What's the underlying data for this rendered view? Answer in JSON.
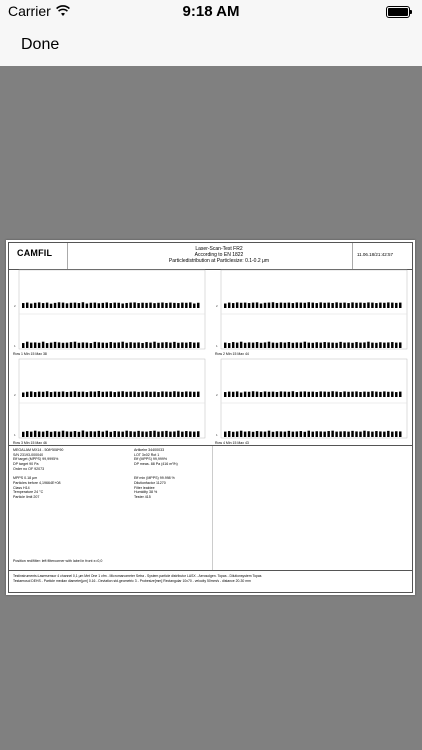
{
  "status_bar": {
    "carrier": "Carrier",
    "time": "9:18 AM"
  },
  "navbar": {
    "done_label": "Done"
  },
  "report": {
    "logo": "CAMFIL",
    "title": "Laser-Scan-Test FR2",
    "standard": "According to EN 1822",
    "distribution": "Particledistribution at Particlesize: 0.1-0.2 μm",
    "datetime": "11.06.18/21:42:57",
    "panels": [
      {
        "row_label": "Row 1 Min 15 Max 38",
        "values_top": [
          0.55,
          0.6,
          0.5,
          0.58,
          0.62,
          0.55,
          0.6,
          0.48,
          0.57,
          0.63,
          0.6,
          0.52,
          0.58,
          0.6,
          0.55,
          0.64,
          0.5,
          0.58,
          0.6,
          0.53,
          0.57,
          0.62,
          0.55,
          0.6,
          0.58,
          0.5,
          0.56,
          0.6,
          0.62,
          0.55,
          0.59,
          0.57,
          0.6,
          0.54,
          0.58,
          0.61,
          0.56,
          0.6,
          0.57,
          0.55,
          0.6,
          0.58,
          0.62,
          0.5,
          0.58
        ],
        "values_bottom": [
          0.55,
          0.7,
          0.6,
          0.62,
          0.58,
          0.7,
          0.55,
          0.6,
          0.68,
          0.62,
          0.58,
          0.6,
          0.65,
          0.7,
          0.58,
          0.62,
          0.6,
          0.55,
          0.68,
          0.63,
          0.6,
          0.58,
          0.66,
          0.6,
          0.62,
          0.7,
          0.58,
          0.64,
          0.6,
          0.62,
          0.56,
          0.66,
          0.6,
          0.7,
          0.58,
          0.62,
          0.65,
          0.6,
          0.68,
          0.58,
          0.62,
          0.6,
          0.66,
          0.6,
          0.62
        ]
      },
      {
        "row_label": "Row 2 Min 15 Max 44",
        "values_top": [
          0.5,
          0.6,
          0.55,
          0.62,
          0.58,
          0.6,
          0.55,
          0.6,
          0.62,
          0.5,
          0.58,
          0.6,
          0.64,
          0.56,
          0.6,
          0.58,
          0.6,
          0.55,
          0.62,
          0.6,
          0.58,
          0.64,
          0.6,
          0.55,
          0.62,
          0.58,
          0.6,
          0.56,
          0.63,
          0.58,
          0.6,
          0.55,
          0.62,
          0.58,
          0.6,
          0.57,
          0.62,
          0.6,
          0.55,
          0.6,
          0.58,
          0.62,
          0.6,
          0.57,
          0.6
        ],
        "values_bottom": [
          0.6,
          0.55,
          0.66,
          0.6,
          0.7,
          0.58,
          0.62,
          0.6,
          0.66,
          0.58,
          0.62,
          0.7,
          0.6,
          0.58,
          0.64,
          0.6,
          0.66,
          0.58,
          0.62,
          0.6,
          0.7,
          0.6,
          0.58,
          0.64,
          0.6,
          0.66,
          0.62,
          0.6,
          0.58,
          0.68,
          0.6,
          0.62,
          0.58,
          0.66,
          0.6,
          0.62,
          0.7,
          0.6,
          0.58,
          0.64,
          0.6,
          0.62,
          0.66,
          0.6,
          0.62
        ]
      },
      {
        "row_label": "Row 3 Min 15 Max 46",
        "values_top": [
          0.5,
          0.58,
          0.62,
          0.55,
          0.6,
          0.58,
          0.64,
          0.55,
          0.6,
          0.58,
          0.62,
          0.56,
          0.6,
          0.64,
          0.58,
          0.6,
          0.55,
          0.62,
          0.6,
          0.66,
          0.58,
          0.6,
          0.62,
          0.55,
          0.6,
          0.64,
          0.58,
          0.6,
          0.62,
          0.57,
          0.6,
          0.63,
          0.58,
          0.6,
          0.55,
          0.62,
          0.6,
          0.58,
          0.64,
          0.6,
          0.57,
          0.62,
          0.6,
          0.58,
          0.6
        ],
        "values_bottom": [
          0.58,
          0.66,
          0.6,
          0.7,
          0.62,
          0.6,
          0.68,
          0.58,
          0.64,
          0.6,
          0.7,
          0.62,
          0.6,
          0.66,
          0.58,
          0.72,
          0.6,
          0.64,
          0.62,
          0.68,
          0.6,
          0.7,
          0.58,
          0.66,
          0.62,
          0.6,
          0.7,
          0.64,
          0.6,
          0.68,
          0.62,
          0.6,
          0.66,
          0.7,
          0.6,
          0.64,
          0.68,
          0.6,
          0.62,
          0.7,
          0.6,
          0.66,
          0.62,
          0.6,
          0.64
        ]
      },
      {
        "row_label": "Row 4 Min 15 Max 43",
        "values_top": [
          0.55,
          0.6,
          0.58,
          0.62,
          0.5,
          0.6,
          0.58,
          0.64,
          0.6,
          0.55,
          0.62,
          0.58,
          0.6,
          0.56,
          0.62,
          0.6,
          0.58,
          0.64,
          0.55,
          0.6,
          0.62,
          0.58,
          0.6,
          0.56,
          0.62,
          0.6,
          0.58,
          0.64,
          0.6,
          0.55,
          0.62,
          0.58,
          0.6,
          0.62,
          0.56,
          0.6,
          0.58,
          0.64,
          0.6,
          0.57,
          0.62,
          0.58,
          0.6,
          0.55,
          0.6
        ],
        "values_bottom": [
          0.6,
          0.66,
          0.58,
          0.62,
          0.7,
          0.6,
          0.64,
          0.58,
          0.66,
          0.62,
          0.6,
          0.7,
          0.58,
          0.64,
          0.62,
          0.6,
          0.68,
          0.6,
          0.62,
          0.66,
          0.58,
          0.7,
          0.6,
          0.64,
          0.62,
          0.6,
          0.66,
          0.7,
          0.6,
          0.62,
          0.64,
          0.6,
          0.68,
          0.62,
          0.6,
          0.7,
          0.64,
          0.6,
          0.66,
          0.62,
          0.6,
          0.68,
          0.6,
          0.64,
          0.62
        ]
      }
    ],
    "info_left": [
      "MEGALAM MX14 - 508*508*90",
      "S/N 23193-000040",
      "Eff target (MPPS) 99,9995%",
      "DP target 90 Pa",
      "Order no OF 92073",
      "",
      "MPPS 0.18 μm",
      "Particles before 4,19664E+08",
      "Class H14",
      "Temperature 24 °C",
      "Particle limit 207"
    ],
    "info_right": [
      "Artikelnr 34400033",
      "LOT 3x02 Rot 1",
      "Eff (MPPS) 99,999%",
      "DP meas. 88 Pa (416 m³/h)",
      "",
      "",
      "Eff min (MPPS) 99.998 %",
      "Dilutionfactor 11270",
      "Filter leaktee",
      "Humidity 38 %",
      "Tester 415"
    ],
    "position_note": "Position red/filter: left filtercorner with label in front x=0,0",
    "footer_1": "Testinstruments:Lasersensor 4 channel 0,1 μm Met One 1 cfm - Micromanometer Setra - System particle distributor LASX - Aerosolgen. Topas - Dilutionsystem Topas",
    "footer_2": "Testaerosol DEHS - Particle median diameter[μm] 0.16 - Deviation std.geometric 3 - Probesize[mm] Rectangular 10x70 - velocity 50mm/s - distance 20-30 mm"
  }
}
